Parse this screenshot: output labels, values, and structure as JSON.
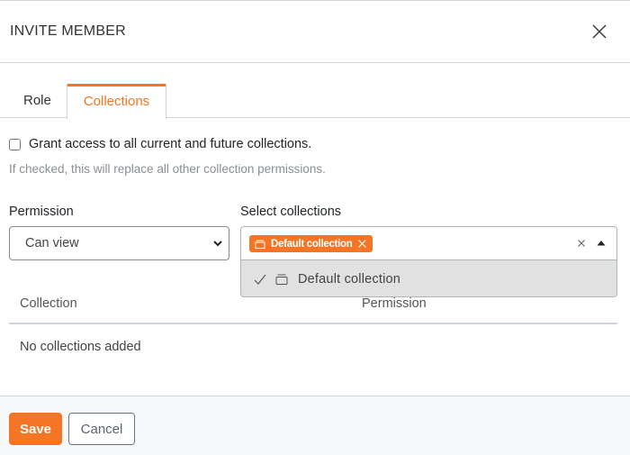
{
  "dialog": {
    "title": "INVITE MEMBER",
    "close_icon": "close-icon"
  },
  "tabs": [
    {
      "label": "Role",
      "active": false
    },
    {
      "label": "Collections",
      "active": true
    }
  ],
  "grant": {
    "label": "Grant access to all current and future collections.",
    "checked": false,
    "hint": "If checked, this will replace all other collection permissions."
  },
  "permission": {
    "label": "Permission",
    "value": "Can view"
  },
  "collections_select": {
    "label": "Select collections",
    "selected_tags": [
      {
        "label": "Default collection",
        "icon": "collection-icon"
      }
    ],
    "options": [
      {
        "label": "Default collection",
        "selected": true,
        "icon": "collection-icon"
      }
    ]
  },
  "table": {
    "headers": [
      "Collection",
      "Permission"
    ],
    "empty_text": "No collections added"
  },
  "footer": {
    "save_label": "Save",
    "cancel_label": "Cancel"
  },
  "colors": {
    "accent": "#f47625",
    "border": "#ced4da",
    "option_bg": "#e1e1e1"
  }
}
